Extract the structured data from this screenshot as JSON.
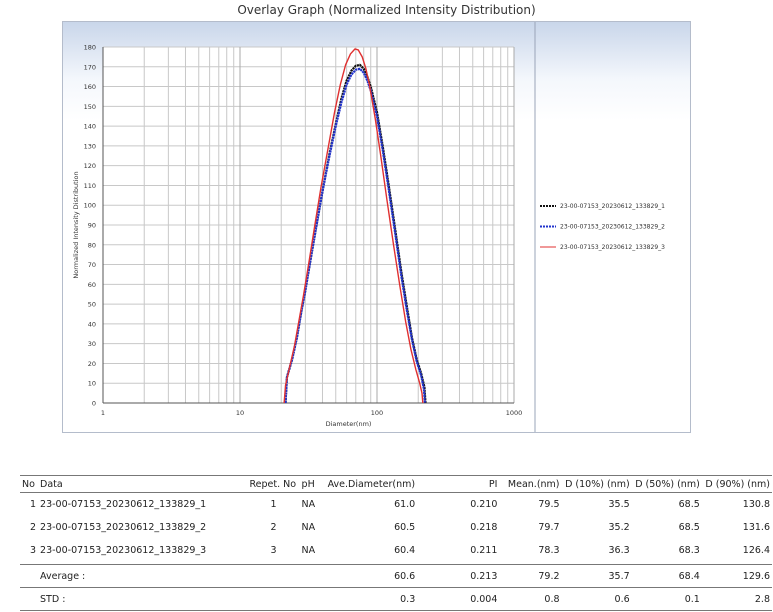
{
  "chart_data": {
    "type": "line",
    "title": "Overlay Graph (Normalized Intensity Distribution)",
    "xlabel": "Diameter(nm)",
    "ylabel": "Normalized Intensity Distribution",
    "x_scale": "log",
    "xlim": [
      1,
      1000
    ],
    "ylim": [
      0,
      180
    ],
    "x_ticks": [
      "1",
      "10",
      "100",
      "1000"
    ],
    "y_ticks": [
      "0",
      "10",
      "20",
      "30",
      "40",
      "50",
      "60",
      "70",
      "80",
      "90",
      "100",
      "110",
      "120",
      "130",
      "140",
      "150",
      "160",
      "170",
      "180"
    ],
    "grid": true,
    "legend_position": "right",
    "series": [
      {
        "name": "23-00-07153_20230612_133829_1",
        "color": "#111111",
        "x": [
          21.5,
          22,
          24,
          26,
          28,
          30,
          33,
          36,
          40,
          45,
          50,
          55,
          60,
          65,
          70,
          75,
          80,
          85,
          90,
          100,
          110,
          120,
          135,
          150,
          165,
          180,
          195,
          210,
          222,
          226
        ],
        "y": [
          0,
          13,
          22,
          33,
          46,
          57,
          74,
          89,
          107,
          126,
          141,
          154,
          163,
          168,
          170.5,
          171,
          169,
          165,
          160,
          147,
          130,
          113,
          89,
          67,
          49,
          33,
          22,
          15,
          8,
          0
        ]
      },
      {
        "name": "23-00-07153_20230612_133829_2",
        "color": "#2233cc",
        "x": [
          21.5,
          22,
          24,
          26,
          28,
          30,
          33,
          36,
          40,
          45,
          50,
          55,
          60,
          65,
          70,
          75,
          80,
          85,
          90,
          100,
          110,
          120,
          135,
          150,
          165,
          180,
          195,
          210,
          220,
          224
        ],
        "y": [
          0,
          13,
          22,
          33,
          46,
          57,
          74,
          89,
          107,
          125,
          140,
          152,
          161,
          166,
          168.5,
          169,
          167,
          163,
          158,
          145,
          128,
          111,
          87,
          65,
          47,
          32,
          21,
          14,
          7,
          0
        ]
      },
      {
        "name": "23-00-07153_20230612_133829_3",
        "color": "#e03030",
        "x": [
          21,
          21.5,
          23,
          25,
          27,
          29,
          32,
          35,
          39,
          44,
          49,
          54,
          59,
          64,
          69,
          73,
          78,
          83,
          88,
          97,
          107,
          118,
          132,
          147,
          162,
          177,
          192,
          205,
          213,
          216
        ],
        "y": [
          0,
          9,
          18,
          29,
          42,
          54,
          72,
          89,
          109,
          129,
          147,
          161,
          171,
          176.5,
          179,
          178.5,
          175,
          169,
          161,
          144,
          124,
          103,
          80,
          59,
          41,
          27,
          17,
          10,
          5,
          0
        ]
      }
    ]
  },
  "table": {
    "headers": [
      "No",
      "Data",
      "Repet. No",
      "pH",
      "Ave.Diameter(nm)",
      "PI",
      "Mean.(nm)",
      "D (10%) (nm)",
      "D (50%) (nm)",
      "D (90%) (nm)"
    ],
    "rows": [
      [
        "1",
        "23-00-07153_20230612_133829_1",
        "1",
        "NA",
        "61.0",
        "0.210",
        "79.5",
        "35.5",
        "68.5",
        "130.8"
      ],
      [
        "2",
        "23-00-07153_20230612_133829_2",
        "2",
        "NA",
        "60.5",
        "0.218",
        "79.7",
        "35.2",
        "68.5",
        "131.6"
      ],
      [
        "3",
        "23-00-07153_20230612_133829_3",
        "3",
        "NA",
        "60.4",
        "0.211",
        "78.3",
        "36.3",
        "68.3",
        "126.4"
      ]
    ],
    "average": {
      "label": "Average :",
      "values": [
        "60.6",
        "0.213",
        "79.2",
        "35.7",
        "68.4",
        "129.6"
      ]
    },
    "std": {
      "label": "STD :",
      "values": [
        "0.3",
        "0.004",
        "0.8",
        "0.6",
        "0.1",
        "2.8"
      ]
    }
  }
}
